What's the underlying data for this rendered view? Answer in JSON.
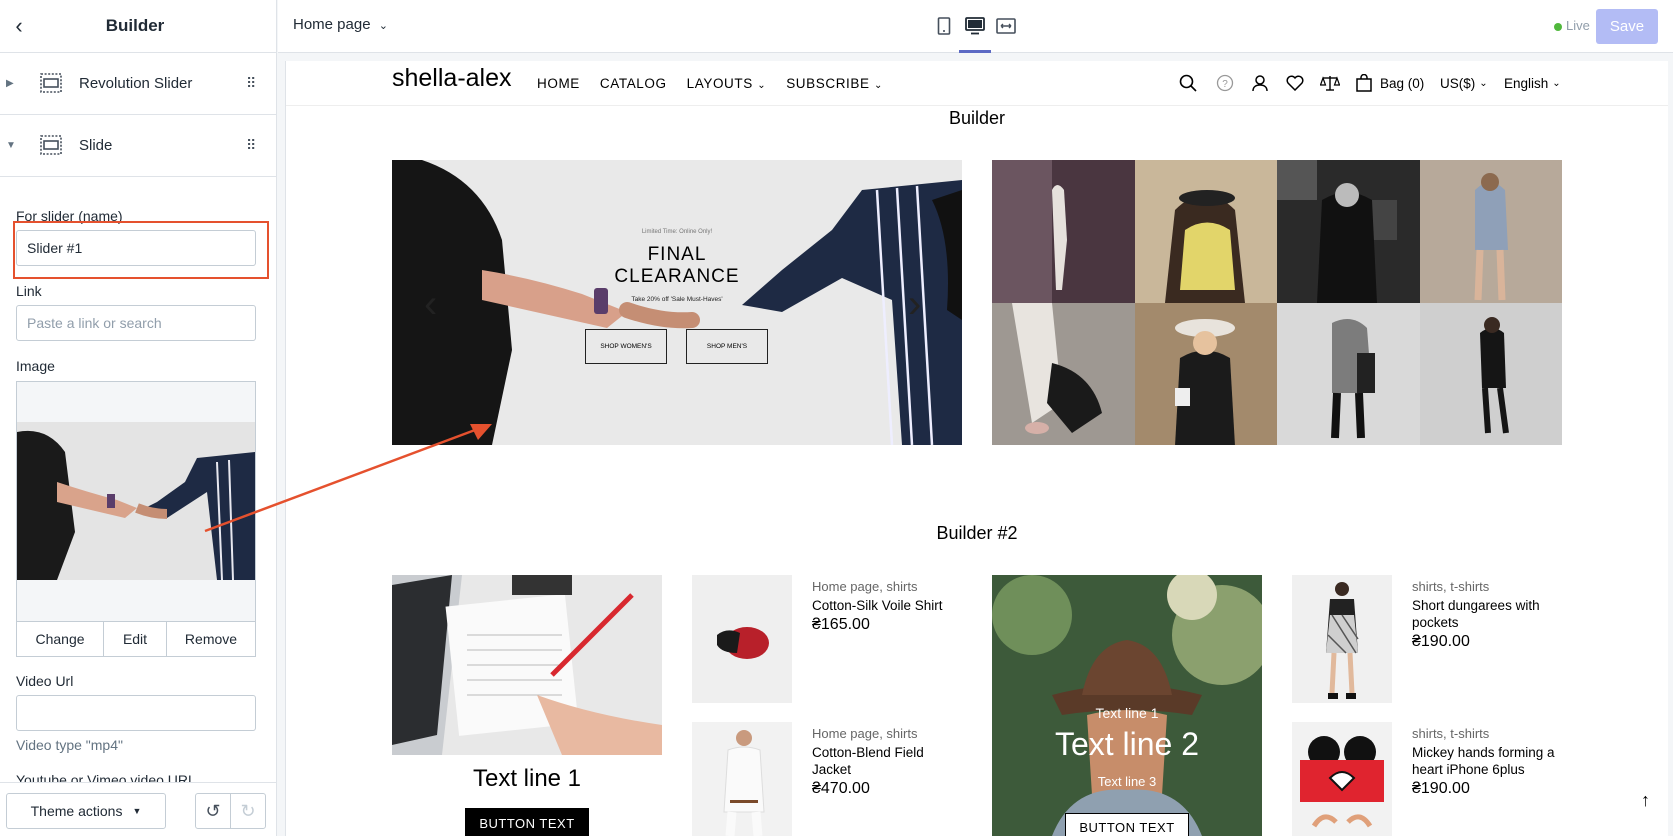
{
  "sidebar": {
    "title": "Builder",
    "sections": [
      {
        "label": "Revolution Slider"
      },
      {
        "label": "Slide"
      }
    ],
    "fields": {
      "slider_name_label": "For slider (name)",
      "slider_name_value": "Slider #1",
      "link_label": "Link",
      "link_placeholder": "Paste a link or search",
      "image_label": "Image",
      "image_actions": [
        "Change",
        "Edit",
        "Remove"
      ],
      "video_url_label": "Video Url",
      "video_type_hint": "Video type \"mp4\"",
      "youtube_label": "Youtube or Vimeo video URL"
    },
    "footer": {
      "theme_actions": "Theme actions"
    }
  },
  "topbar": {
    "page_select": "Home page",
    "devices": [
      "mobile-icon",
      "desktop-icon",
      "fullscreen-icon"
    ],
    "active_device": "desktop",
    "live_label": "Live",
    "save_label": "Save"
  },
  "store": {
    "logo": "shella-alex",
    "nav": [
      "HOME",
      "CATALOG",
      "LAYOUTS",
      "SUBSCRIBE"
    ],
    "bag": "Bag (0)",
    "currency": "US($)",
    "language": "English",
    "builder_title": "Builder",
    "hero": {
      "kicker": "Limited Time: Online Only!",
      "headline_1": "FINAL",
      "headline_2": "CLEARANCE",
      "sub": "Take 20% off 'Sale Must-Haves'",
      "btn_women": "SHOP WOMEN'S",
      "btn_men": "SHOP MEN'S"
    },
    "builder2_title": "Builder #2",
    "promo_left": {
      "text_line_1": "Text line 1",
      "button": "BUTTON TEXT"
    },
    "promo_center": {
      "text_line_1": "Text line 1",
      "text_line_2": "Text line 2",
      "text_line_3": "Text line 3",
      "button": "BUTTON TEXT"
    },
    "products": [
      {
        "meta": "Home page, shirts",
        "name": "Cotton-Silk Voile Shirt",
        "price": "₴165.00"
      },
      {
        "meta": "Home page, shirts",
        "name": "Cotton-Blend Field Jacket",
        "price": "₴470.00"
      },
      {
        "meta": "shirts, t-shirts",
        "name": "Short dungarees with pockets",
        "price": "₴190.00"
      },
      {
        "meta": "shirts, t-shirts",
        "name": "Mickey hands forming a heart iPhone 6plus",
        "price": "₴190.00"
      }
    ]
  },
  "colors": {
    "accent": "#5c6ac4",
    "annotation": "#e5512e",
    "save_disabled": "#b3bcf5",
    "live": "#50b83c"
  }
}
